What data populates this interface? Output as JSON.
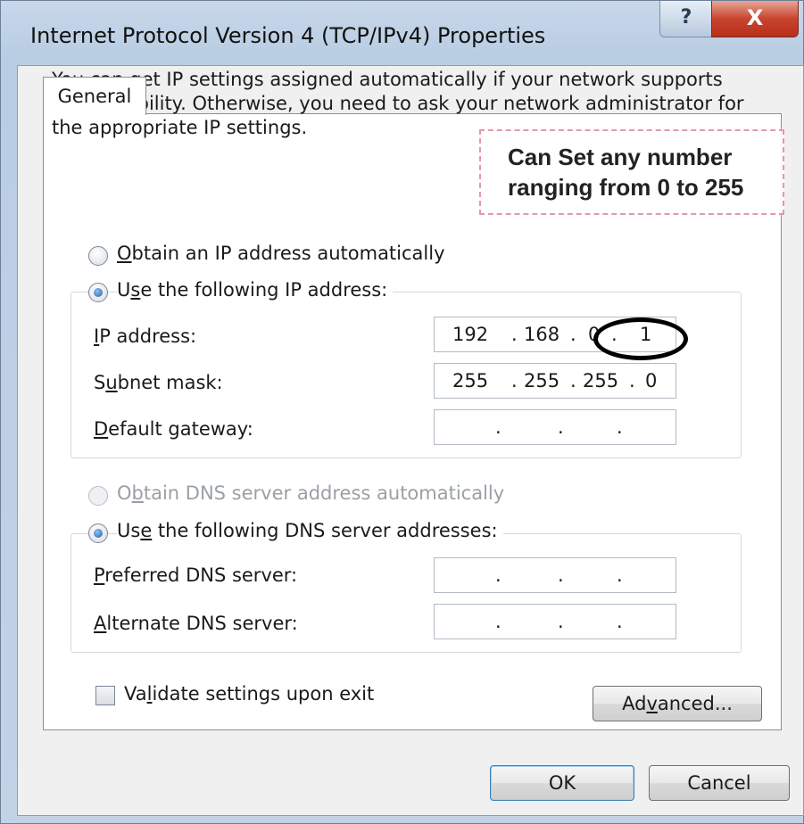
{
  "window": {
    "title": "Internet Protocol Version 4 (TCP/IPv4) Properties",
    "help_glyph": "?",
    "close_glyph": "X"
  },
  "tabs": [
    {
      "label": "General",
      "selected": true
    }
  ],
  "intro_text": "You can get IP settings assigned automatically if your network supports this capability. Otherwise, you need to ask your network administrator for the appropriate IP settings.",
  "callout": {
    "line1": "Can Set any number",
    "line2": "ranging from 0 to 255"
  },
  "ip_section": {
    "auto_option": {
      "pre": "",
      "accel": "O",
      "post": "btain an IP address automatically",
      "checked": false
    },
    "manual_option": {
      "pre": "U",
      "accel": "s",
      "post": "e the following IP address:",
      "checked": true
    },
    "fields": [
      {
        "pre": "",
        "accel": "I",
        "post": "P address:",
        "octets": [
          "192",
          "168",
          "0",
          "1"
        ]
      },
      {
        "pre": "S",
        "accel": "u",
        "post": "bnet mask:",
        "octets": [
          "255",
          "255",
          "255",
          "0"
        ]
      },
      {
        "pre": "",
        "accel": "D",
        "post": "efault gateway:",
        "octets": [
          "",
          "",
          "",
          ""
        ]
      }
    ]
  },
  "dns_section": {
    "auto_option": {
      "pre": "O",
      "accel": "b",
      "post": "tain DNS server address automatically",
      "checked": false,
      "disabled": true
    },
    "manual_option": {
      "pre": "Us",
      "accel": "e",
      "post": " the following DNS server addresses:",
      "checked": true
    },
    "fields": [
      {
        "pre": "",
        "accel": "P",
        "post": "referred DNS server:",
        "octets": [
          "",
          "",
          "",
          ""
        ]
      },
      {
        "pre": "",
        "accel": "A",
        "post": "lternate DNS server:",
        "octets": [
          "",
          "",
          "",
          ""
        ]
      }
    ]
  },
  "validate": {
    "pre": "Va",
    "accel": "l",
    "post": "idate settings upon exit",
    "checked": false
  },
  "buttons": {
    "advanced": {
      "pre": "Ad",
      "accel": "v",
      "post": "anced..."
    },
    "ok": "OK",
    "cancel": "Cancel"
  },
  "colors": {
    "accent": "#1f5fa3",
    "callout_border": "#e39aa8",
    "close_button": "#c8442f"
  },
  "dot": "."
}
